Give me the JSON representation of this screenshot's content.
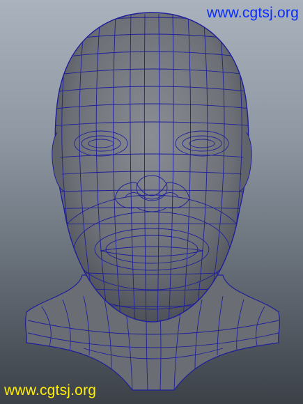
{
  "viewport": {
    "background_top": "#aab3bd",
    "background_bottom": "#3c4148"
  },
  "model": {
    "surface_color": "#6e7278",
    "wireframe_color": "#1e1e9a"
  },
  "watermarks": {
    "top_right": "www.cgtsj.org",
    "bottom_left": "www.cgtsj.org",
    "top_right_color": "#0a2cff",
    "bottom_left_color": "#ffee00"
  }
}
